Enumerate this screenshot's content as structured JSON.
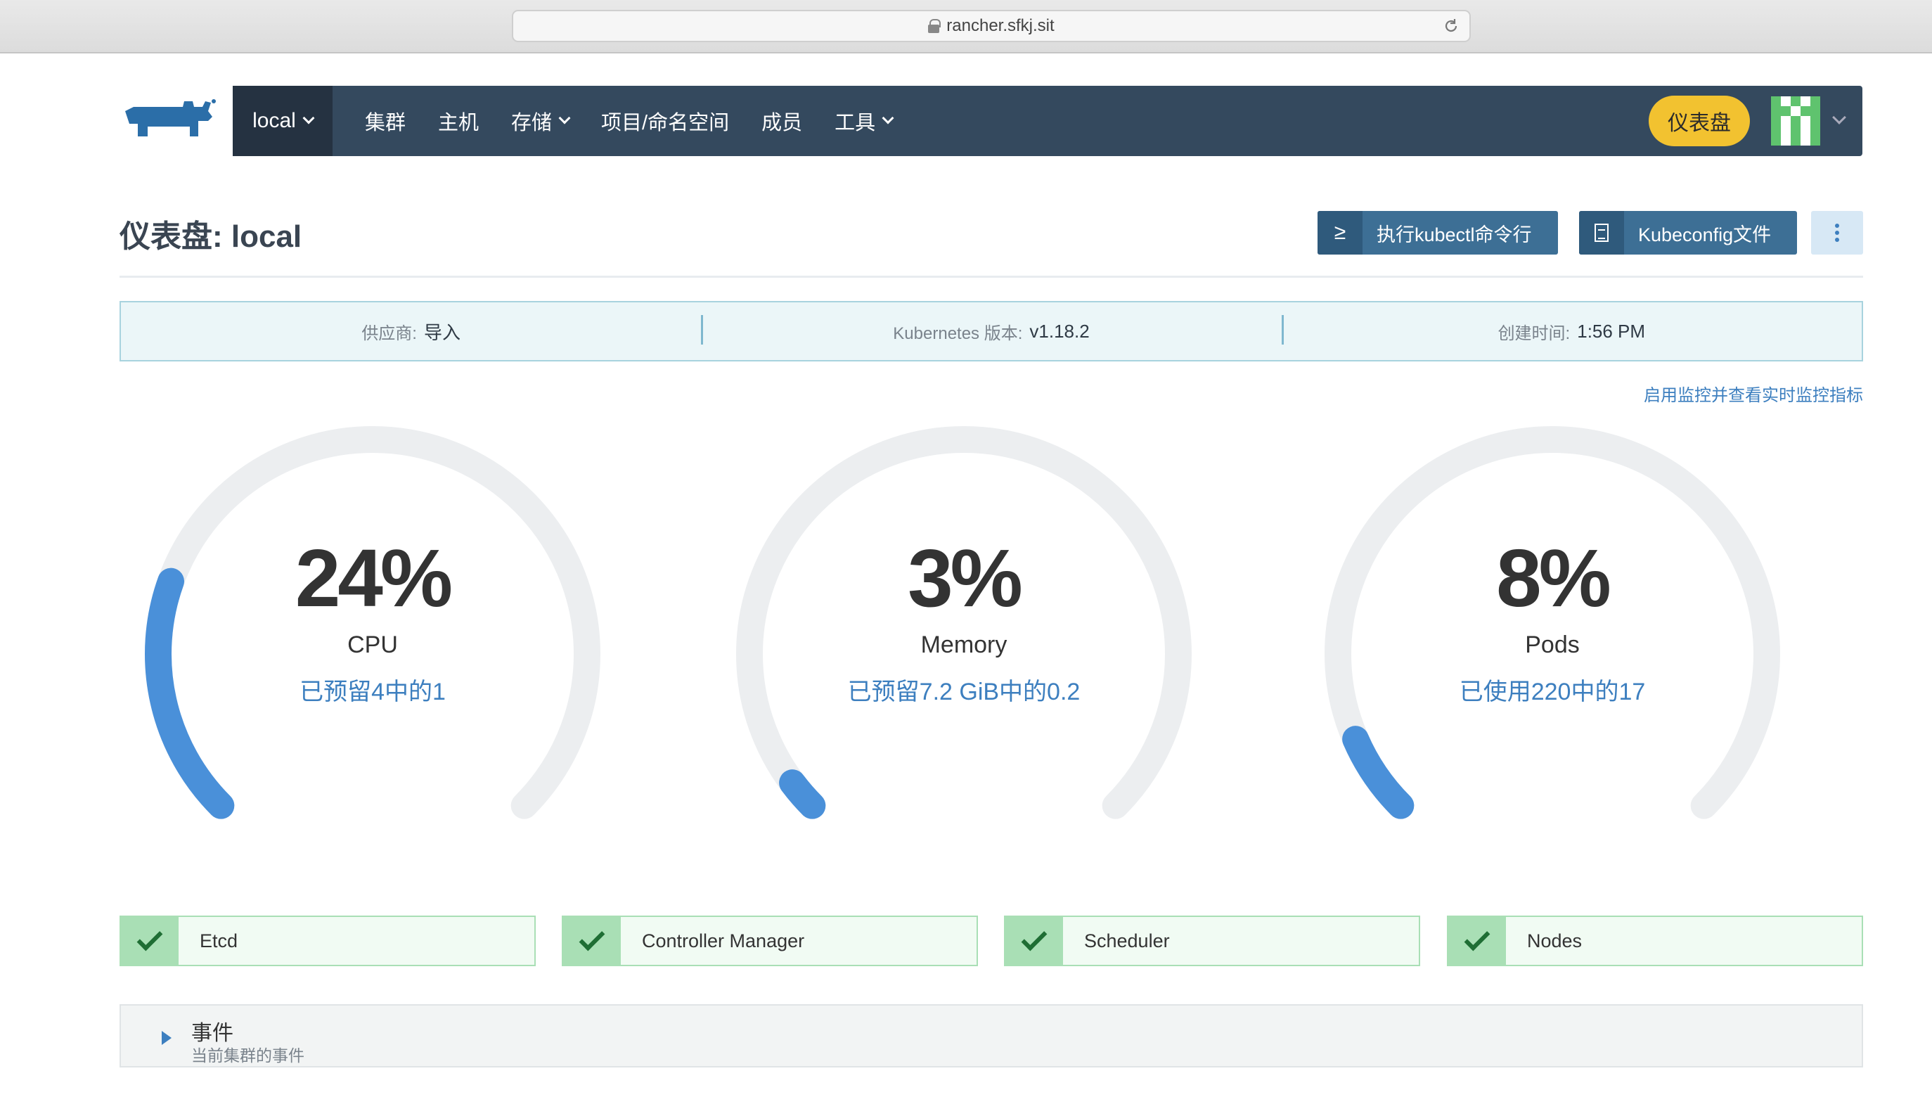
{
  "browser": {
    "url": "rancher.sfkj.sit"
  },
  "nav": {
    "cluster": "local",
    "items": [
      {
        "label": "集群",
        "dropdown": false
      },
      {
        "label": "主机",
        "dropdown": false
      },
      {
        "label": "存储",
        "dropdown": true
      },
      {
        "label": "项目/命名空间",
        "dropdown": false
      },
      {
        "label": "成员",
        "dropdown": false
      },
      {
        "label": "工具",
        "dropdown": true
      }
    ],
    "dashboard_button": "仪表盘"
  },
  "header": {
    "title": "仪表盘: local",
    "kubectl_label": "执行kubectl命令行",
    "kubectl_icon": "≥",
    "kubeconfig_label": "Kubeconfig文件"
  },
  "info": {
    "provider_label": "供应商:",
    "provider_value": "导入",
    "k8s_label": "Kubernetes 版本:",
    "k8s_value": "v1.18.2",
    "created_label": "创建时间:",
    "created_value": "1:56 PM"
  },
  "monitor_link": "启用监控并查看实时监控指标",
  "gauges": [
    {
      "value": "24%",
      "label": "CPU",
      "sub": "已预留4中的1",
      "fraction": 0.24
    },
    {
      "value": "3%",
      "label": "Memory",
      "sub": "已预留7.2 GiB中的0.2",
      "fraction": 0.03
    },
    {
      "value": "8%",
      "label": "Pods",
      "sub": "已使用220中的17",
      "fraction": 0.08
    }
  ],
  "components": [
    {
      "name": "Etcd"
    },
    {
      "name": "Controller Manager"
    },
    {
      "name": "Scheduler"
    },
    {
      "name": "Nodes"
    }
  ],
  "events": {
    "title": "事件",
    "subtitle": "当前集群的事件"
  },
  "colors": {
    "nav_bg": "#34495e",
    "accent": "#3d7fbf",
    "dashboard_btn": "#f2c230",
    "healthy": "#a9dfb5"
  }
}
